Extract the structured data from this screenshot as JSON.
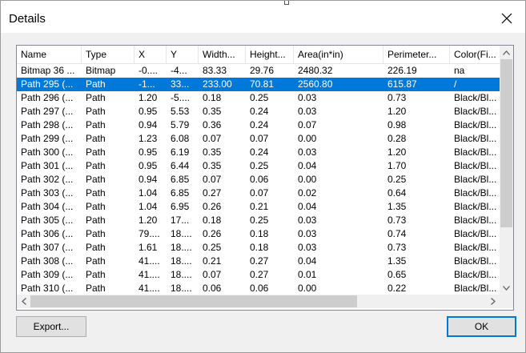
{
  "window": {
    "title": "Details"
  },
  "columns": [
    "Name",
    "Type",
    "X",
    "Y",
    "Width...",
    "Height...",
    "Area(in*in)",
    "Perimeter...",
    "Color(Fi..."
  ],
  "rows": [
    [
      "Bitmap 36 ...",
      "Bitmap",
      "-0....",
      "-4...",
      "83.33",
      "29.76",
      "2480.32",
      "226.19",
      "na"
    ],
    [
      "Path 295 (...",
      "Path",
      "-1...",
      "33...",
      "233.00",
      "70.81",
      "2560.80",
      "615.87",
      "/"
    ],
    [
      "Path 296 (...",
      "Path",
      "1.20",
      "-5....",
      "0.18",
      "0.25",
      "0.03",
      "0.73",
      "Black/Bl..."
    ],
    [
      "Path 297 (...",
      "Path",
      "0.95",
      "5.53",
      "0.35",
      "0.24",
      "0.03",
      "1.20",
      "Black/Bl..."
    ],
    [
      "Path 298 (...",
      "Path",
      "0.94",
      "5.79",
      "0.36",
      "0.24",
      "0.07",
      "0.98",
      "Black/Bl..."
    ],
    [
      "Path 299 (...",
      "Path",
      "1.23",
      "6.08",
      "0.07",
      "0.07",
      "0.00",
      "0.28",
      "Black/Bl..."
    ],
    [
      "Path 300 (...",
      "Path",
      "0.95",
      "6.19",
      "0.35",
      "0.24",
      "0.03",
      "1.20",
      "Black/Bl..."
    ],
    [
      "Path 301 (...",
      "Path",
      "0.95",
      "6.44",
      "0.35",
      "0.25",
      "0.04",
      "1.70",
      "Black/Bl..."
    ],
    [
      "Path 302 (...",
      "Path",
      "0.94",
      "6.85",
      "0.07",
      "0.06",
      "0.00",
      "0.25",
      "Black/Bl..."
    ],
    [
      "Path 303 (...",
      "Path",
      "1.04",
      "6.85",
      "0.27",
      "0.07",
      "0.02",
      "0.64",
      "Black/Bl..."
    ],
    [
      "Path 304 (...",
      "Path",
      "1.04",
      "6.95",
      "0.26",
      "0.21",
      "0.04",
      "1.35",
      "Black/Bl..."
    ],
    [
      "Path 305 (...",
      "Path",
      "1.20",
      "17...",
      "0.18",
      "0.25",
      "0.03",
      "0.73",
      "Black/Bl..."
    ],
    [
      "Path 306 (...",
      "Path",
      "79....",
      "18....",
      "0.26",
      "0.18",
      "0.03",
      "0.74",
      "Black/Bl..."
    ],
    [
      "Path 307 (...",
      "Path",
      "1.61",
      "18....",
      "0.25",
      "0.18",
      "0.03",
      "0.73",
      "Black/Bl..."
    ],
    [
      "Path 308 (...",
      "Path",
      "41....",
      "18....",
      "0.21",
      "0.27",
      "0.04",
      "1.35",
      "Black/Bl..."
    ],
    [
      "Path 309 (...",
      "Path",
      "41....",
      "18....",
      "0.07",
      "0.27",
      "0.01",
      "0.65",
      "Black/Bl..."
    ],
    [
      "Path 310 (...",
      "Path",
      "41....",
      "18....",
      "0.06",
      "0.06",
      "0.00",
      "0.22",
      "Black/Bl..."
    ]
  ],
  "selected_row": 1,
  "buttons": {
    "export": "Export...",
    "ok": "OK"
  },
  "icons": {
    "close": "close-icon",
    "up": "scroll-up-arrow-icon",
    "down": "scroll-down-arrow-icon",
    "left": "scroll-left-arrow-icon",
    "right": "scroll-right-arrow-icon"
  },
  "colors": {
    "selection": "#0078d7",
    "selection_text": "#ffffff",
    "default_button_border": "#0078d7"
  }
}
